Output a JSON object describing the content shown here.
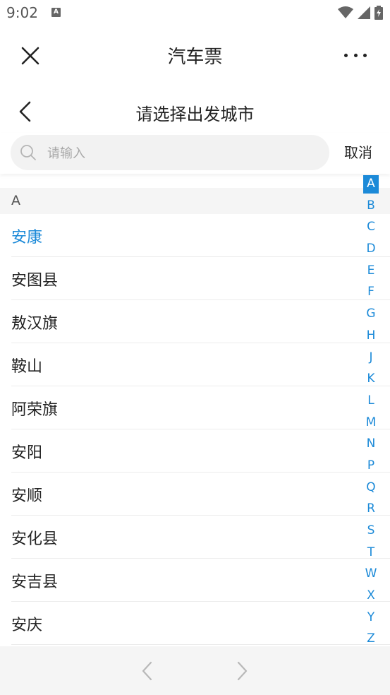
{
  "status_bar": {
    "time": "9:02",
    "app_icon_letter": "A"
  },
  "titlebar": {
    "title": "汽车票"
  },
  "subheader": {
    "title": "请选择出发城市"
  },
  "search": {
    "placeholder": "请输入",
    "value": "",
    "cancel_label": "取消"
  },
  "section": {
    "letter": "A"
  },
  "cities": [
    {
      "name": "安康",
      "active": true
    },
    {
      "name": "安图县",
      "active": false
    },
    {
      "name": "敖汉旗",
      "active": false
    },
    {
      "name": "鞍山",
      "active": false
    },
    {
      "name": "阿荣旗",
      "active": false
    },
    {
      "name": "安阳",
      "active": false
    },
    {
      "name": "安顺",
      "active": false
    },
    {
      "name": "安化县",
      "active": false
    },
    {
      "name": "安吉县",
      "active": false
    },
    {
      "name": "安庆",
      "active": false
    }
  ],
  "alphabet_index": [
    "A",
    "B",
    "C",
    "D",
    "E",
    "F",
    "G",
    "H",
    "J",
    "K",
    "L",
    "M",
    "N",
    "P",
    "Q",
    "R",
    "S",
    "T",
    "W",
    "X",
    "Y",
    "Z"
  ],
  "alphabet_active": "A",
  "colors": {
    "accent": "#1c8ad8",
    "section_bg": "#f5f5f5",
    "search_bg": "#f2f2f2"
  }
}
